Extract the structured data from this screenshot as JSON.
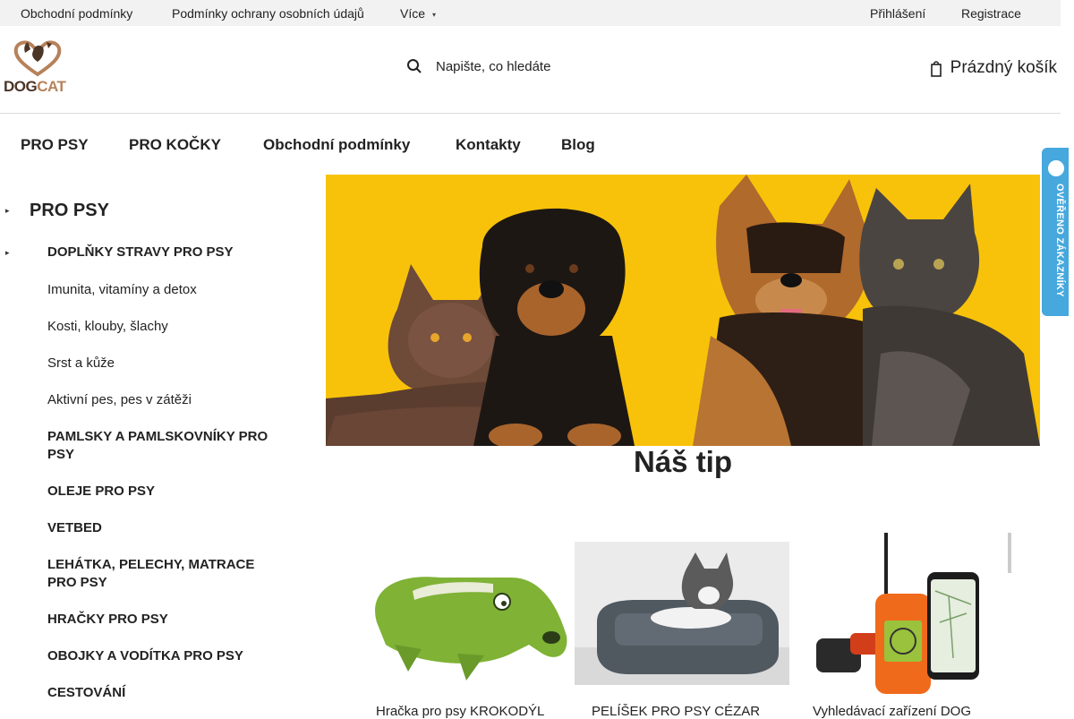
{
  "topbar": {
    "links": [
      "Obchodní podmínky",
      "Podmínky ochrany osobních údajů",
      "Více"
    ],
    "more_caret": "▾",
    "login": "Přihlášení",
    "register": "Registrace"
  },
  "header": {
    "logo_text_dog": "DOG",
    "logo_text_cat": "CAT",
    "search_placeholder": "Napište, co hledáte",
    "cart_label": "Prázdný košík"
  },
  "nav": {
    "items": [
      "PRO PSY",
      "PRO KOČKY",
      "Obchodní podmínky",
      "Kontakty",
      "Blog"
    ]
  },
  "sidebar": {
    "top": "PRO PSY",
    "items": [
      "DOPLŇKY STRAVY PRO PSY",
      "Imunita, vitamíny a detox",
      "Kosti, klouby, šlachy",
      "Srst a kůže",
      "Aktivní pes, pes v zátěži",
      "PAMLSKY A PAMLSKOVNÍKY PRO PSY",
      "OLEJE PRO PSY",
      "VETBED",
      "LEHÁTKA, PELECHY, MATRACE PRO PSY",
      "HRAČKY PRO PSY",
      "OBOJKY A VODÍTKA PRO PSY",
      "CESTOVÁNÍ"
    ],
    "marker": "▸"
  },
  "badge": {
    "text": "OVĚŘENO ZÁKAZNÍKY"
  },
  "tips": {
    "title": "Náš tip",
    "products": [
      "Hračka pro psy KROKODÝL",
      "PELÍŠEK PRO PSY CÉZAR",
      "Vyhledávací zařízení DOG"
    ]
  },
  "colors": {
    "banner": "#f8c20a",
    "badge": "#46a8dd",
    "logo_dark": "#4b3527",
    "logo_light": "#b7825a"
  }
}
